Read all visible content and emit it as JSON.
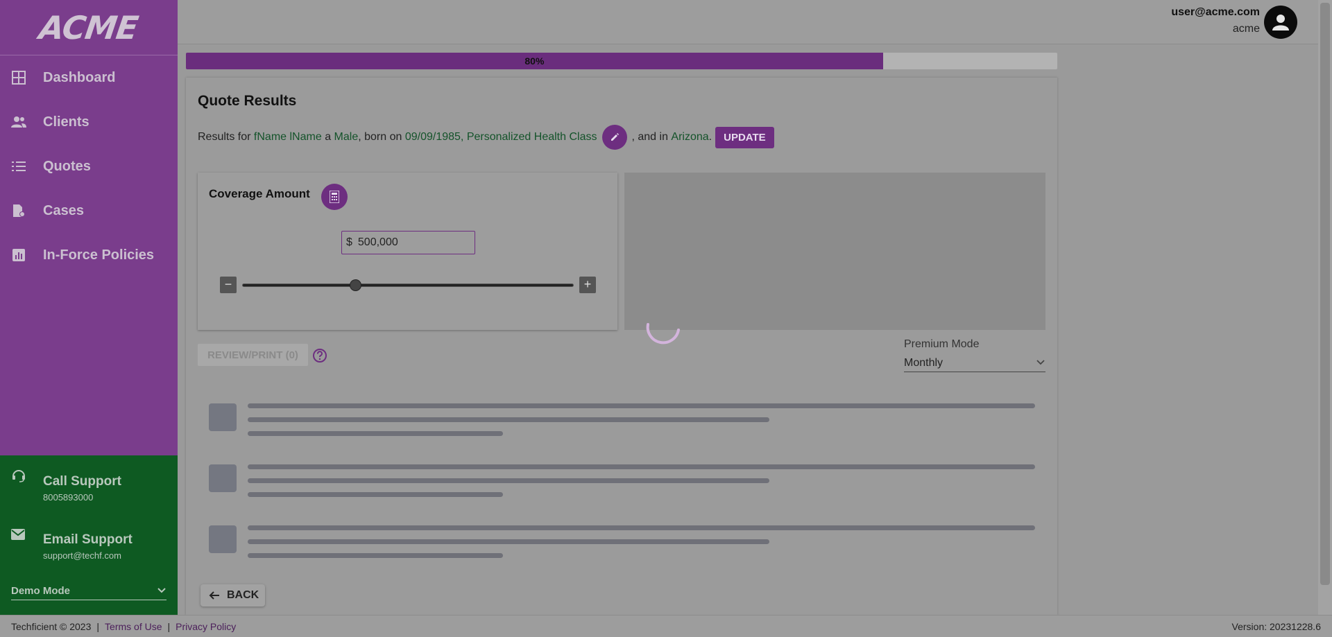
{
  "sidebar": {
    "logo": "ACME",
    "nav": [
      {
        "label": "Dashboard",
        "icon": "dashboard-icon"
      },
      {
        "label": "Clients",
        "icon": "people-icon"
      },
      {
        "label": "Quotes",
        "icon": "list-icon"
      },
      {
        "label": "Cases",
        "icon": "case-icon"
      },
      {
        "label": "In-Force Policies",
        "icon": "chart-icon"
      }
    ],
    "support": {
      "call_label": "Call Support",
      "call_value": "8005893000",
      "email_label": "Email Support",
      "email_value": "support@techf.com",
      "mode_select": "Demo Mode"
    }
  },
  "header": {
    "user_email": "user@acme.com",
    "user_org": "acme"
  },
  "progress": {
    "label": "80%",
    "value": 0.8
  },
  "quote": {
    "title": "Quote Results",
    "results_prefix": "Results for",
    "name": "fName lName",
    "article": "a",
    "gender": "Male",
    "born_on": ", born on",
    "dob": "09/09/1985",
    "comma": ",",
    "health_class": "Personalized Health Class",
    "and_in": ", and in",
    "state": "Arizona",
    "period": ".",
    "update_label": "UPDATE"
  },
  "coverage": {
    "title": "Coverage Amount",
    "currency": "$",
    "amount": "500,000",
    "minus": "−",
    "plus": "+",
    "slider_fraction": 0.34
  },
  "actions": {
    "review_label": "REVIEW/PRINT (0)",
    "premium_mode_label": "Premium Mode",
    "premium_mode_value": "Monthly",
    "back_label": "BACK"
  },
  "footer": {
    "copyright": "Techficient © 2023",
    "terms": "Terms of Use",
    "privacy": "Privacy Policy",
    "version": "Version: 20231228.6"
  },
  "colors": {
    "sidebar": "#7a3d8c",
    "support_panel": "#0e5a22",
    "accent": "#6d2e80",
    "highlight_text": "#14532a"
  }
}
